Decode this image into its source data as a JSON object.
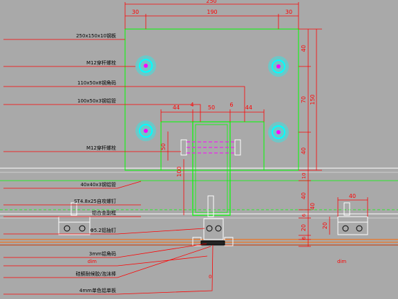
{
  "colors": {
    "background": "#a9a9a9",
    "dimension": "#ff0000",
    "outline": "#00ff00",
    "bolt": "#00ffff",
    "bolt_dashed": "#ff00ff",
    "pink_line": "#ff00ff",
    "label": "#000000"
  },
  "top_dims": {
    "overall": "250",
    "left": "30",
    "middle": "190",
    "right": "30"
  },
  "inner_dims": {
    "a": "44",
    "b": "4",
    "c": "50",
    "d": "6",
    "e": "44"
  },
  "right_dims": {
    "d1": "40",
    "d2": "70",
    "d3": "40",
    "total": "150",
    "d4": "10",
    "d5": "40",
    "d6": "40",
    "d7": "6",
    "d8": "20",
    "d9": "6"
  },
  "misc_dims": {
    "vertical_left": "50",
    "vertical_post": "100",
    "small_clip": "40",
    "clip_height": "20"
  },
  "labels": [
    "250x150x10钢板",
    "M12穿杆螺栓",
    "110x50x8钢角码",
    "100x50x3钢铝管",
    "M12穿杆螺栓",
    "40x40x3钢铝管",
    "ST4.8x25自攻螺钉",
    "铝合金副框",
    "Φ5.2铝抽钉",
    "3mm铝角码",
    "dim",
    "硅酮耐候胶/泡沫棒",
    "4mm单色铝单板"
  ],
  "right_dim_text": "dim",
  "center_zero": "0"
}
